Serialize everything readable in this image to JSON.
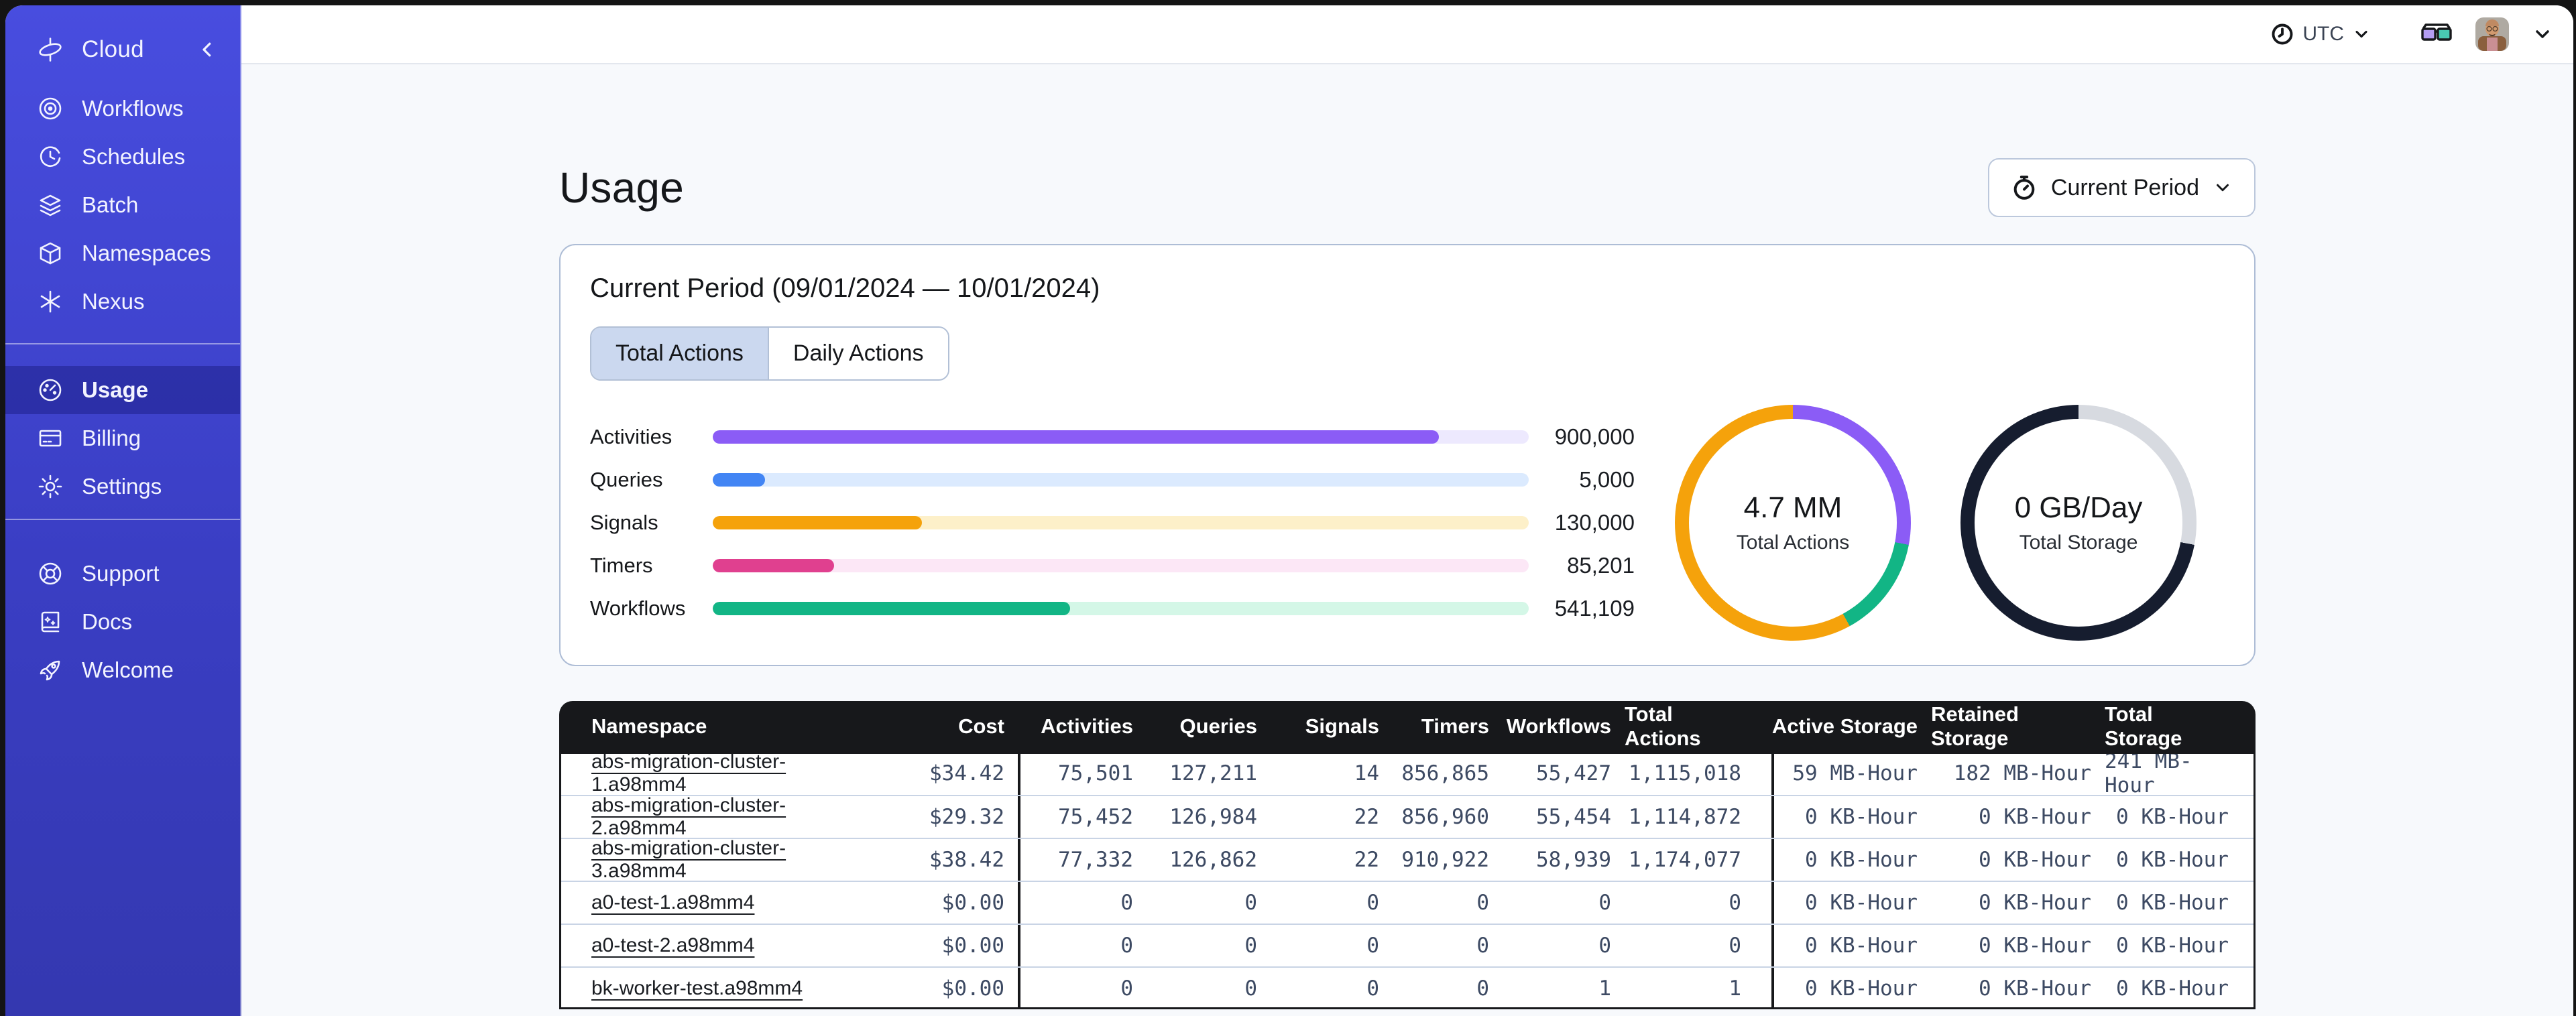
{
  "sidebar": {
    "brand": {
      "label": "Cloud"
    },
    "nav": [
      {
        "label": "Workflows"
      },
      {
        "label": "Schedules"
      },
      {
        "label": "Batch"
      },
      {
        "label": "Namespaces"
      },
      {
        "label": "Nexus"
      }
    ],
    "account": [
      {
        "label": "Usage",
        "active": true
      },
      {
        "label": "Billing",
        "active": false
      },
      {
        "label": "Settings",
        "active": false
      }
    ],
    "footer": [
      {
        "label": "Support"
      },
      {
        "label": "Docs"
      },
      {
        "label": "Welcome"
      }
    ]
  },
  "topbar": {
    "timezone": "UTC"
  },
  "page": {
    "title": "Usage",
    "period_button_label": "Current Period"
  },
  "card": {
    "title": "Current Period (09/01/2024 — 10/01/2024)",
    "tabs": [
      {
        "label": "Total Actions",
        "selected": true
      },
      {
        "label": "Daily Actions",
        "selected": false
      }
    ]
  },
  "chart_data": [
    {
      "type": "bar",
      "orientation": "horizontal",
      "categories": [
        "Activities",
        "Queries",
        "Signals",
        "Timers",
        "Workflows"
      ],
      "values": [
        900000,
        5000,
        130000,
        85201,
        541109
      ],
      "display_values": [
        "900,000",
        "5,000",
        "130,000",
        "85,201",
        "541,109"
      ],
      "fill_pct": [
        89,
        6.4,
        25.6,
        14.9,
        43.8
      ],
      "colors": [
        "#8B5CF6",
        "#4285F4",
        "#F5A20B",
        "#E0408F",
        "#12B585"
      ],
      "track_colors": [
        "#EDE9FE",
        "#DBEAFE",
        "#FDF0C9",
        "#FCE7F6",
        "#D4F7E7"
      ]
    },
    {
      "type": "pie",
      "title": "Total Actions",
      "center_value": "4.7 MM",
      "center_label": "Total Actions",
      "segments": [
        {
          "name": "activities",
          "color": "#8B5CF6",
          "pct": 28
        },
        {
          "name": "workflows",
          "color": "#12B585",
          "pct": 14
        },
        {
          "name": "signals",
          "color": "#F5A20B",
          "pct": 58
        }
      ]
    },
    {
      "type": "pie",
      "title": "Total Storage",
      "center_value": "0 GB/Day",
      "center_label": "Total Storage",
      "segments": [
        {
          "name": "retained",
          "color": "#D7DAE0",
          "pct": 28
        },
        {
          "name": "active",
          "color": "#161D2F",
          "pct": 72
        }
      ]
    }
  ],
  "table": {
    "columns": [
      "Namespace",
      "Cost",
      "Activities",
      "Queries",
      "Signals",
      "Timers",
      "Workflows",
      "Total Actions",
      "Active Storage",
      "Retained Storage",
      "Total Storage"
    ],
    "rows": [
      [
        "abs-migration-cluster-1.a98mm4",
        "$34.42",
        "75,501",
        "127,211",
        "14",
        "856,865",
        "55,427",
        "1,115,018",
        "59 MB-Hour",
        "182 MB-Hour",
        "241 MB-Hour"
      ],
      [
        "abs-migration-cluster-2.a98mm4",
        "$29.32",
        "75,452",
        "126,984",
        "22",
        "856,960",
        "55,454",
        "1,114,872",
        "0 KB-Hour",
        "0 KB-Hour",
        "0 KB-Hour"
      ],
      [
        "abs-migration-cluster-3.a98mm4",
        "$38.42",
        "77,332",
        "126,862",
        "22",
        "910,922",
        "58,939",
        "1,174,077",
        "0 KB-Hour",
        "0 KB-Hour",
        "0 KB-Hour"
      ],
      [
        "a0-test-1.a98mm4",
        "$0.00",
        "0",
        "0",
        "0",
        "0",
        "0",
        "0",
        "0 KB-Hour",
        "0 KB-Hour",
        "0 KB-Hour"
      ],
      [
        "a0-test-2.a98mm4",
        "$0.00",
        "0",
        "0",
        "0",
        "0",
        "0",
        "0",
        "0 KB-Hour",
        "0 KB-Hour",
        "0 KB-Hour"
      ],
      [
        "bk-worker-test.a98mm4",
        "$0.00",
        "0",
        "0",
        "0",
        "0",
        "1",
        "1",
        "0 KB-Hour",
        "0 KB-Hour",
        "0 KB-Hour"
      ]
    ]
  }
}
